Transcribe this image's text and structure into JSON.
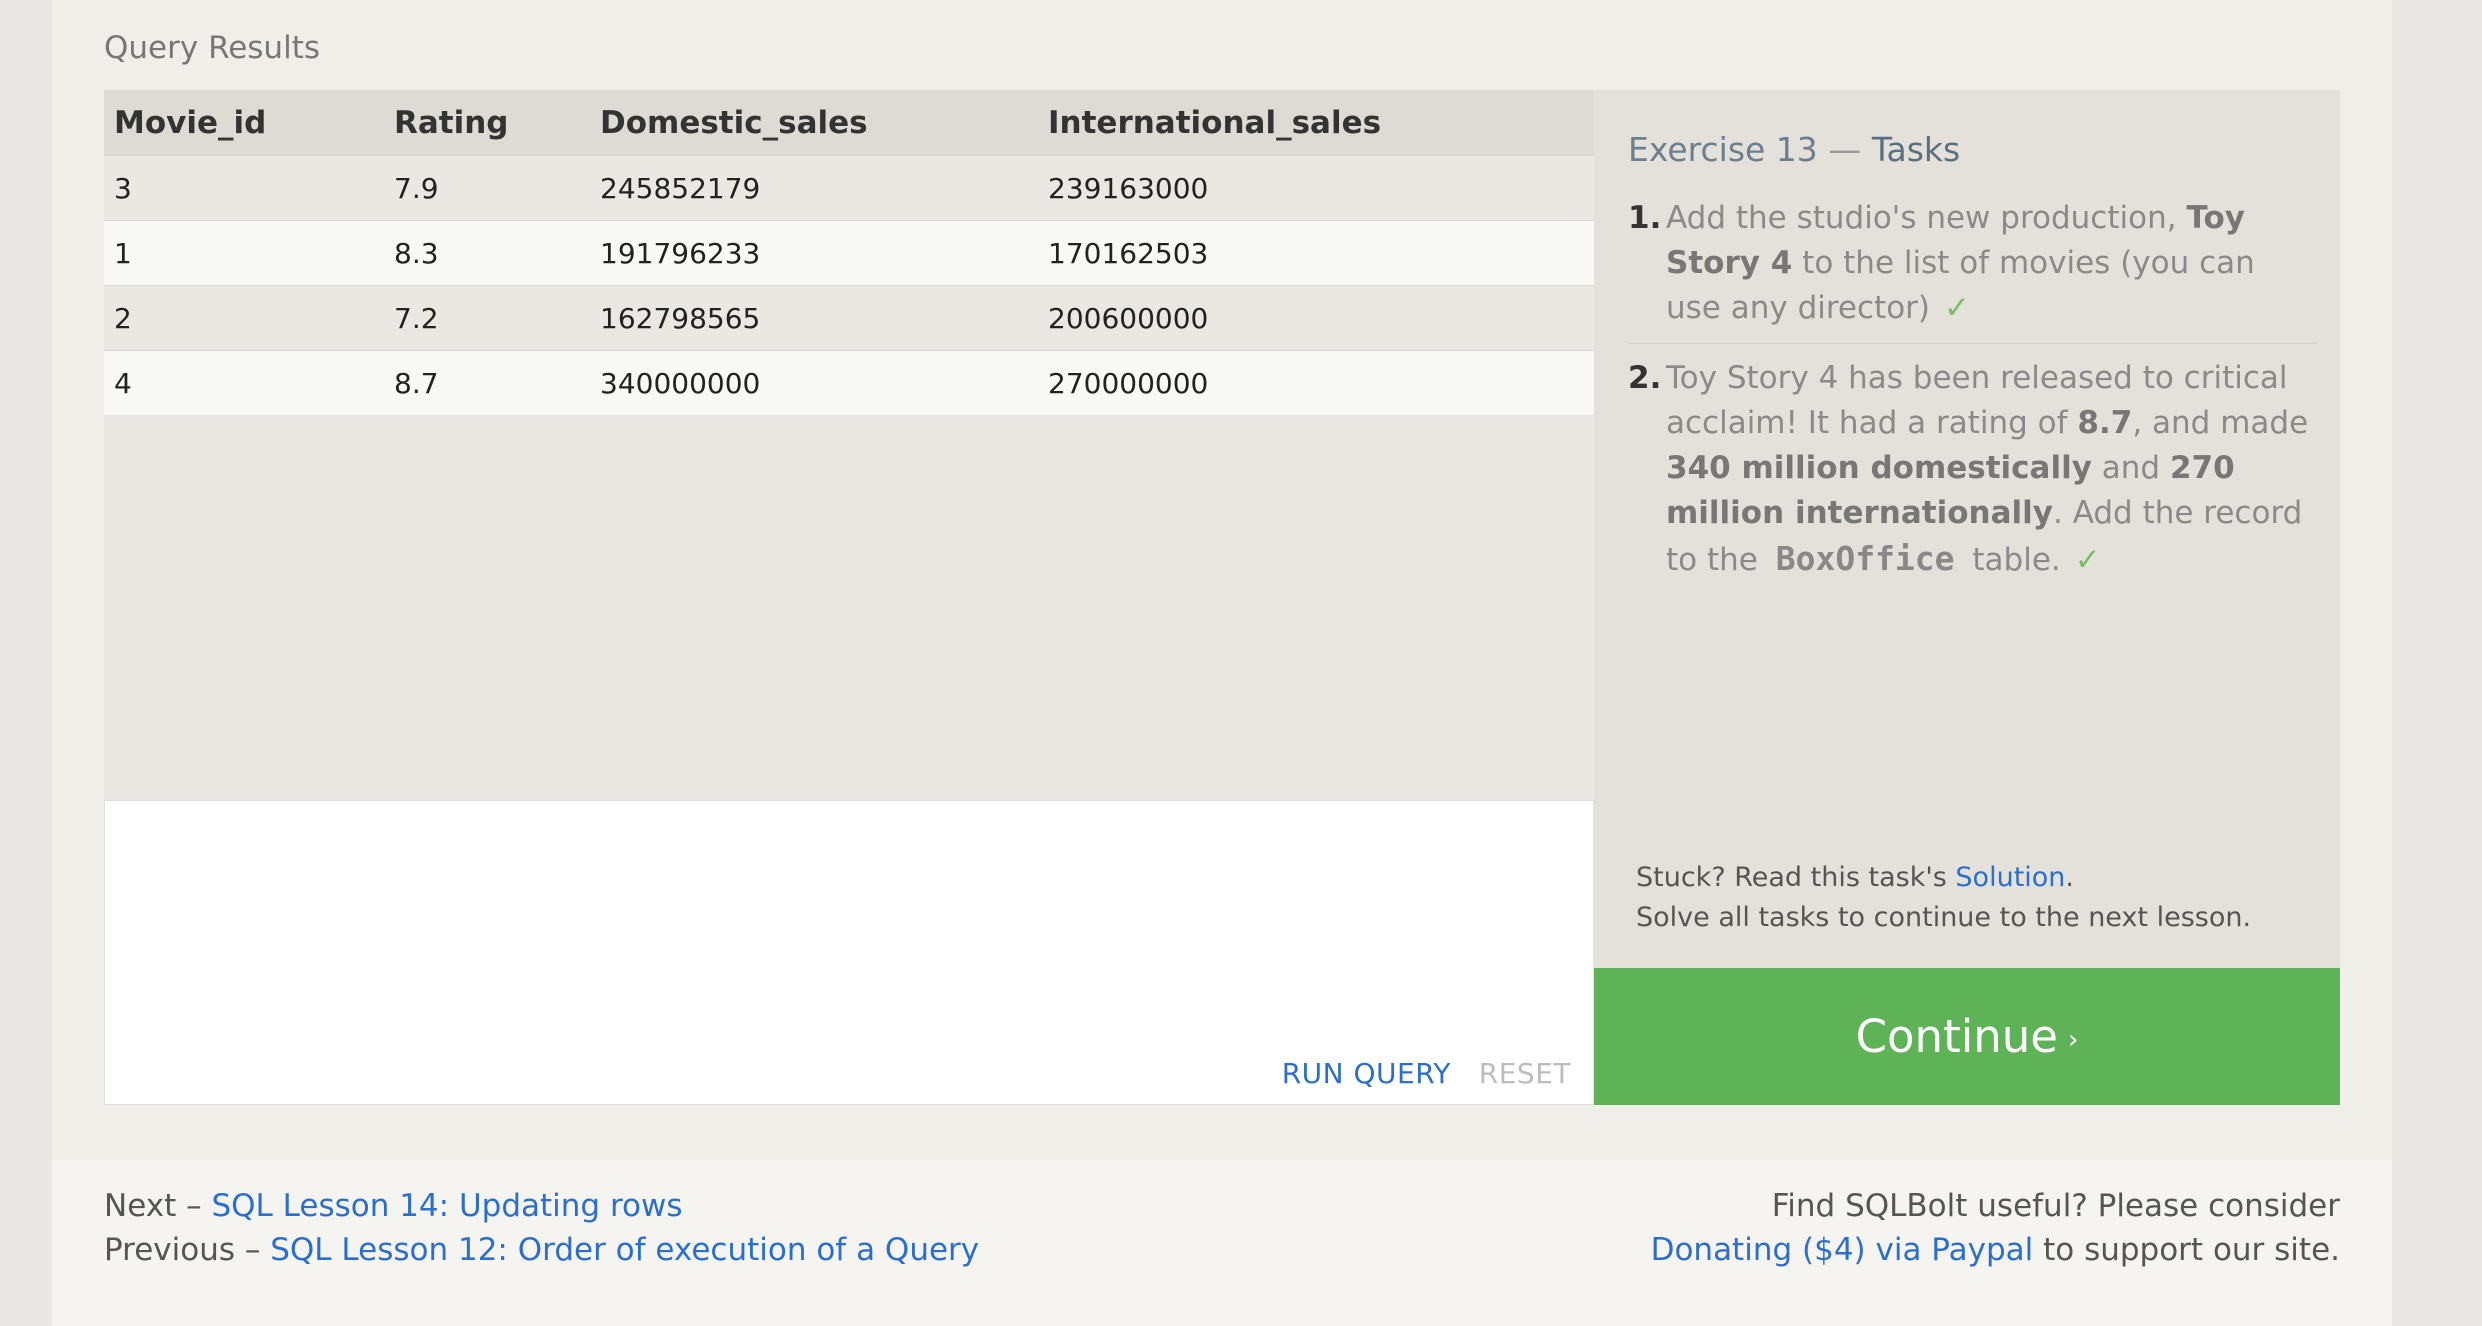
{
  "results": {
    "label": "Query Results",
    "columns": [
      "Movie_id",
      "Rating",
      "Domestic_sales",
      "International_sales"
    ],
    "rows": [
      [
        "3",
        "7.9",
        "245852179",
        "239163000"
      ],
      [
        "1",
        "8.3",
        "191796233",
        "170162503"
      ],
      [
        "2",
        "7.2",
        "162798565",
        "200600000"
      ],
      [
        "4",
        "8.7",
        "340000000",
        "270000000"
      ]
    ]
  },
  "editor": {
    "run_label": "RUN QUERY",
    "reset_label": "RESET"
  },
  "tasks": {
    "exercise": "Exercise 13",
    "dash": "—",
    "tasks_word": "Tasks",
    "task1": {
      "num": "1.",
      "t1": "Add the studio's new production, ",
      "b1": "Toy Story 4",
      "t2": " to the list of movies (you can use any director)",
      "check": "✓"
    },
    "task2": {
      "num": "2.",
      "t1": "Toy Story 4 has been released to critical acclaim! It had a rating of ",
      "b1": "8.7",
      "t2": ", and made ",
      "b2": "340 million domestically",
      "t3": " and ",
      "b3": "270 million internationally",
      "t4": ". Add the record to the ",
      "code": "BoxOffice",
      "t5": " table.",
      "check": "✓"
    },
    "stuck_prefix": "Stuck? Read this task's ",
    "solution_link": "Solution",
    "stuck_suffix": ".",
    "solve_all": "Solve all tasks to continue to the next lesson."
  },
  "continue": {
    "label": "Continue",
    "chevron": "›"
  },
  "footer": {
    "next_prefix": "Next – ",
    "next_link": "SQL Lesson 14: Updating rows",
    "prev_prefix": "Previous – ",
    "prev_link": "SQL Lesson 12: Order of execution of a Query",
    "donate_line1": "Find SQLBolt useful? Please consider",
    "donate_link": "Donating ($4) via Paypal",
    "donate_suffix": " to support our site."
  },
  "colors": {
    "accent_link": "#2a6fcf",
    "continue_bg": "#5fb357",
    "check": "#7dbd6a"
  }
}
